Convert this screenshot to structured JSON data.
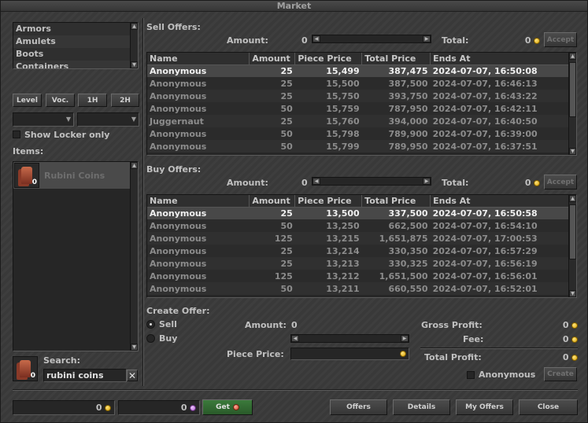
{
  "window": {
    "title": "Market"
  },
  "categories": [
    "Armors",
    "Amulets",
    "Boots",
    "Containers"
  ],
  "filters": {
    "level": "Level",
    "vocation": "Voc.",
    "one_hand": "1H",
    "two_hand": "2H",
    "show_locker_only": "Show Locker only"
  },
  "items_section": {
    "label": "Items:",
    "items": [
      {
        "name": "Rubini Coins",
        "count": "0"
      }
    ]
  },
  "search": {
    "label": "Search:",
    "value": "rubini coins",
    "item_count": "0"
  },
  "sell_offers": {
    "title": "Sell Offers:",
    "amount_label": "Amount:",
    "amount_value": "0",
    "total_label": "Total:",
    "total_value": "0",
    "accept_label": "Accept",
    "columns": [
      "Name",
      "Amount",
      "Piece Price",
      "Total Price",
      "Ends At"
    ],
    "rows": [
      [
        "Anonymous",
        "25",
        "15,499",
        "387,475",
        "2024-07-07, 16:50:08"
      ],
      [
        "Anonymous",
        "25",
        "15,500",
        "387,500",
        "2024-07-07, 16:46:13"
      ],
      [
        "Anonymous",
        "25",
        "15,750",
        "393,750",
        "2024-07-07, 16:43:22"
      ],
      [
        "Anonymous",
        "50",
        "15,759",
        "787,950",
        "2024-07-07, 16:42:11"
      ],
      [
        "Juggernaut",
        "25",
        "15,760",
        "394,000",
        "2024-07-07, 16:40:50"
      ],
      [
        "Anonymous",
        "50",
        "15,798",
        "789,900",
        "2024-07-07, 16:39:00"
      ],
      [
        "Anonymous",
        "50",
        "15,799",
        "789,950",
        "2024-07-07, 16:37:51"
      ]
    ]
  },
  "buy_offers": {
    "title": "Buy Offers:",
    "amount_label": "Amount:",
    "amount_value": "0",
    "total_label": "Total:",
    "total_value": "0",
    "accept_label": "Accept",
    "columns": [
      "Name",
      "Amount",
      "Piece Price",
      "Total Price",
      "Ends At"
    ],
    "rows": [
      [
        "Anonymous",
        "25",
        "13,500",
        "337,500",
        "2024-07-07, 16:50:58"
      ],
      [
        "Anonymous",
        "50",
        "13,250",
        "662,500",
        "2024-07-07, 16:54:10"
      ],
      [
        "Anonymous",
        "125",
        "13,215",
        "1,651,875",
        "2024-07-07, 17:00:53"
      ],
      [
        "Anonymous",
        "25",
        "13,214",
        "330,350",
        "2024-07-07, 16:57:29"
      ],
      [
        "Anonymous",
        "25",
        "13,213",
        "330,325",
        "2024-07-07, 16:56:19"
      ],
      [
        "Anonymous",
        "125",
        "13,212",
        "1,651,500",
        "2024-07-07, 16:56:01"
      ],
      [
        "Anonymous",
        "50",
        "13,211",
        "660,550",
        "2024-07-07, 16:52:01"
      ]
    ]
  },
  "create_offer": {
    "title": "Create Offer:",
    "sell_label": "Sell",
    "buy_label": "Buy",
    "selected": "sell",
    "amount_label": "Amount:",
    "amount_value": "0",
    "piece_price_label": "Piece Price:",
    "gross_profit_label": "Gross Profit:",
    "gross_profit_value": "0",
    "fee_label": "Fee:",
    "fee_value": "0",
    "total_profit_label": "Total Profit:",
    "total_profit_value": "0",
    "anonymous_label": "Anonymous",
    "create_label": "Create"
  },
  "bottom": {
    "gold_balance": "0",
    "tc_balance": "0",
    "get_label": "Get",
    "offers_label": "Offers",
    "details_label": "Details",
    "my_offers_label": "My Offers",
    "close_label": "Close"
  },
  "colors": {
    "background": "#3b3b3b",
    "panel": "#262626",
    "selected_row": "#484848",
    "text": "#c0c0c0",
    "dim_text": "#8c8c8c",
    "gold": "#d9a000",
    "get_button": "#2f6a2f"
  }
}
